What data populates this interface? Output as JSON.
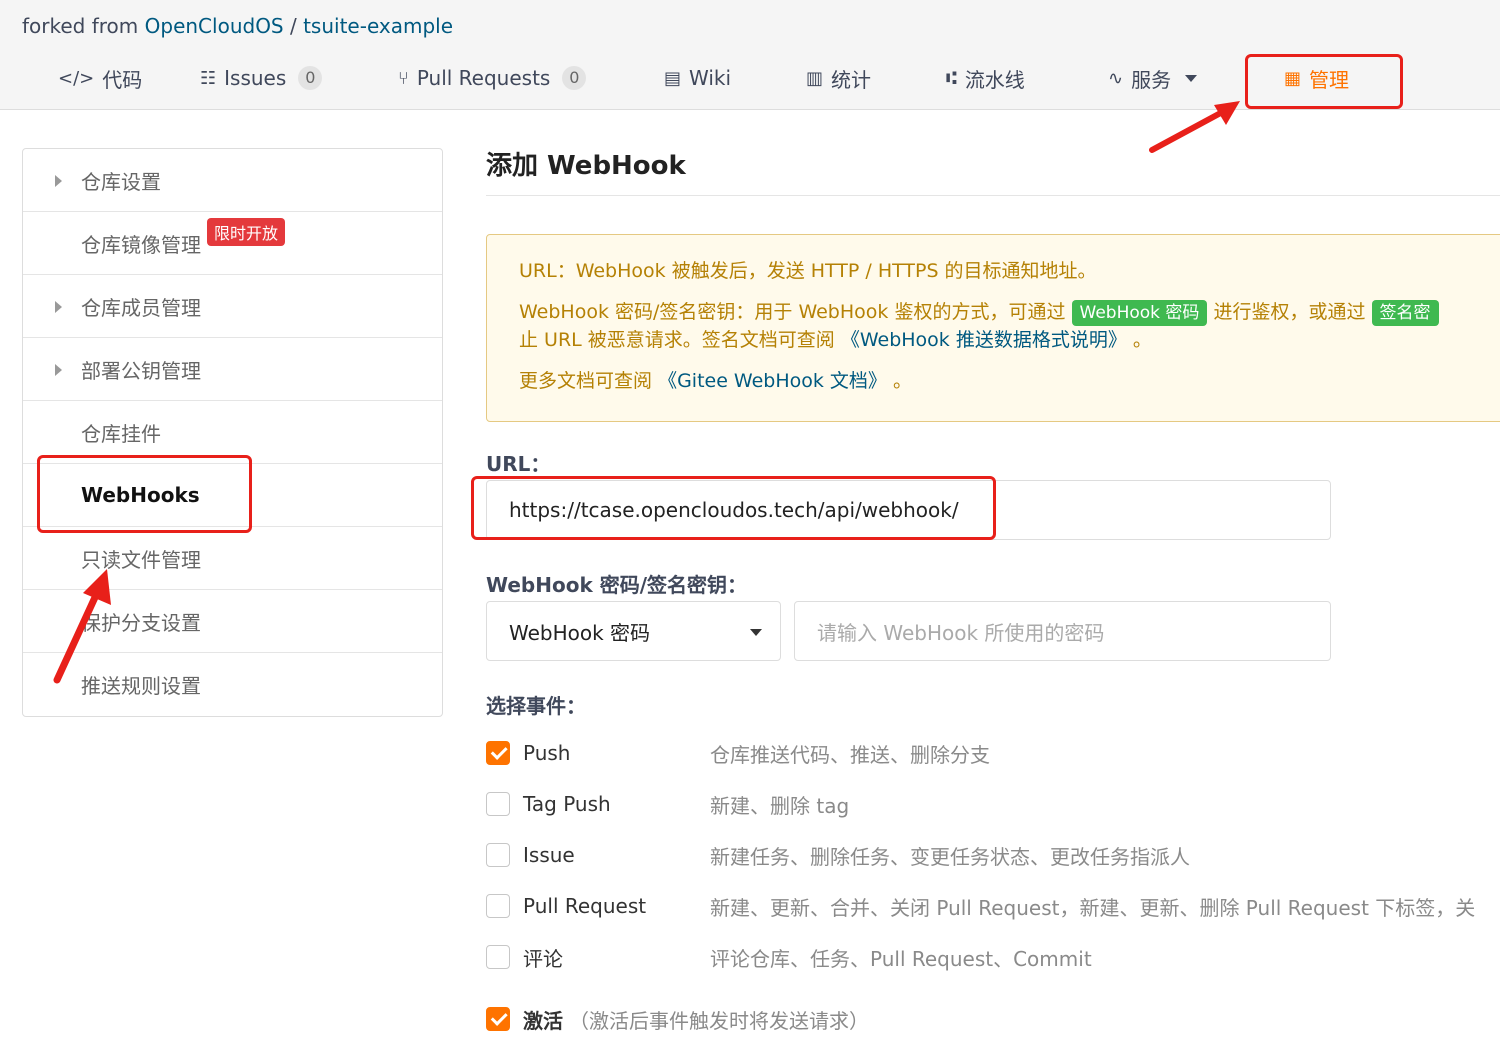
{
  "header": {
    "forked_prefix": "forked from",
    "owner": "OpenCloudOS",
    "separator": "/",
    "repo": "tsuite-example",
    "nav": [
      {
        "label": "代码",
        "icon": "code-icon"
      },
      {
        "label": "Issues",
        "icon": "issues-icon",
        "count": "0"
      },
      {
        "label": "Pull Requests",
        "icon": "pull-request-icon",
        "count": "0"
      },
      {
        "label": "Wiki",
        "icon": "wiki-icon"
      },
      {
        "label": "统计",
        "icon": "stats-icon"
      },
      {
        "label": "流水线",
        "icon": "pipeline-icon"
      },
      {
        "label": "服务",
        "icon": "service-icon"
      },
      {
        "label": "管理",
        "icon": "manage-icon",
        "active": true
      }
    ]
  },
  "sidebar": {
    "items": [
      {
        "label": "仓库设置",
        "expandable": true
      },
      {
        "label": "仓库镜像管理",
        "badge": "限时开放"
      },
      {
        "label": "仓库成员管理",
        "expandable": true
      },
      {
        "label": "部署公钥管理",
        "expandable": true
      },
      {
        "label": "仓库挂件"
      },
      {
        "label": "WebHooks",
        "active": true
      },
      {
        "label": "只读文件管理"
      },
      {
        "label": "保护分支设置"
      },
      {
        "label": "推送规则设置"
      }
    ]
  },
  "main": {
    "title": "添加 WebHook",
    "notice": {
      "line1": "URL：WebHook 被触发后，发送 HTTP / HTTPS 的目标通知地址。",
      "line2_a": "WebHook 密码/签名密钥：用于 WebHook 鉴权的方式，可通过",
      "line2_tag1": "WebHook 密码",
      "line2_b": "进行鉴权，或通过",
      "line2_tag2": "签名密",
      "line3_a": "止 URL 被恶意请求。签名文档可查阅",
      "line3_link": "《WebHook 推送数据格式说明》",
      "line3_b": "。",
      "line4_a": "更多文档可查阅",
      "line4_link": "《Gitee WebHook 文档》",
      "line4_b": "。"
    },
    "url_label": "URL：",
    "url_value": "https://tcase.opencloudos.tech/api/webhook/",
    "secret_label": "WebHook 密码/签名密钥：",
    "secret_type": "WebHook 密码",
    "secret_placeholder": "请输入 WebHook 所使用的密码",
    "events_label": "选择事件：",
    "events": [
      {
        "name": "Push",
        "desc": "仓库推送代码、推送、删除分支",
        "checked": true
      },
      {
        "name": "Tag Push",
        "desc": "新建、删除 tag",
        "checked": false
      },
      {
        "name": "Issue",
        "desc": "新建任务、删除任务、变更任务状态、更改任务指派人",
        "checked": false
      },
      {
        "name": "Pull Request",
        "desc": "新建、更新、合并、关闭 Pull Request，新建、更新、删除 Pull Request 下标签，关",
        "checked": false
      },
      {
        "name": "评论",
        "desc": "评论仓库、任务、Pull Request、Commit",
        "checked": false
      }
    ],
    "active_label": "激活",
    "active_note": "（激活后事件触发时将发送请求）",
    "active_checked": true
  },
  "colors": {
    "accent": "#fe7300",
    "annotation": "#e8201a",
    "notice_bg": "#fffaeb",
    "link": "#005980"
  }
}
